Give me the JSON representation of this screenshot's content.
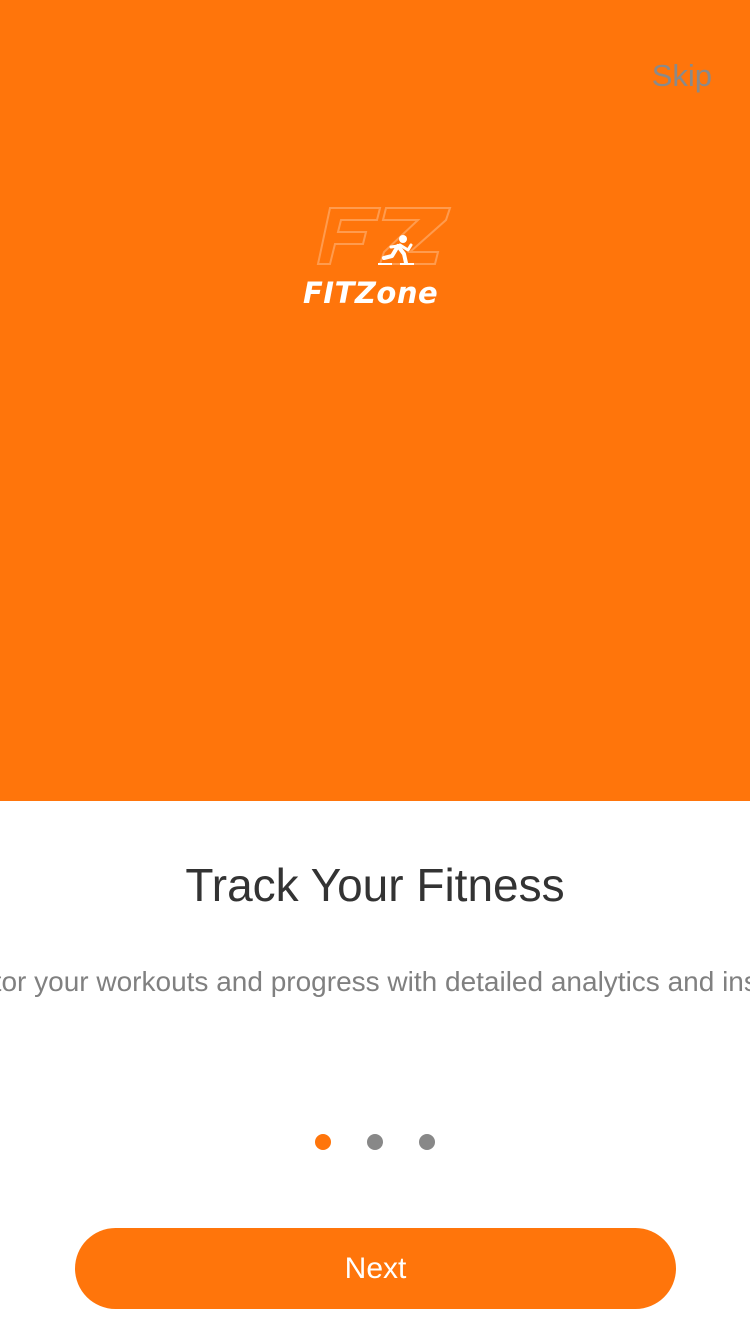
{
  "colors": {
    "brand": "#FF750B",
    "skip_text": "#8a8a8a",
    "title_text": "#333333",
    "description_text": "#808080",
    "dot_inactive": "#888888",
    "button_text": "#ffffff"
  },
  "header": {
    "skip_label": "Skip"
  },
  "logo": {
    "icon": "runner-icon",
    "text": "FITZone"
  },
  "slide": {
    "title": "Track Your Fitness",
    "description": "Monitor your workouts and progress with detailed analytics and insights"
  },
  "pagination": {
    "total": 3,
    "current": 1
  },
  "footer": {
    "next_label": "Next"
  }
}
